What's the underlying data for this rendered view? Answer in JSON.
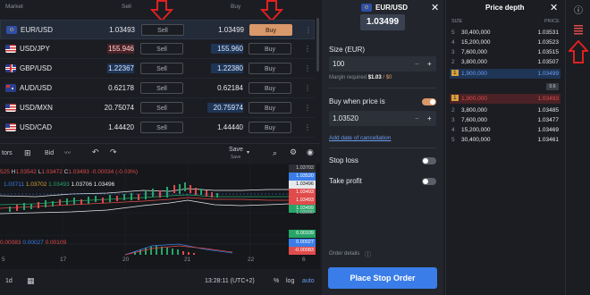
{
  "market": {
    "header": {
      "market": "Market",
      "sell": "Sell",
      "buy": "Buy"
    },
    "rows": [
      {
        "symbol": "EUR/USD",
        "sell_price": "1.03493",
        "sell_label": "Sell",
        "buy_price": "1.03499",
        "buy_label": "Buy",
        "selected": true
      },
      {
        "symbol": "USD/JPY",
        "sell_price": "155.946",
        "sell_label": "Sell",
        "buy_price": "155.960",
        "buy_label": "Buy"
      },
      {
        "symbol": "GBP/USD",
        "sell_price": "1.22367",
        "sell_label": "Sell",
        "buy_price": "1.22380",
        "buy_label": "Buy"
      },
      {
        "symbol": "AUD/USD",
        "sell_price": "0.62178",
        "sell_label": "Sell",
        "buy_price": "0.62184",
        "buy_label": "Buy"
      },
      {
        "symbol": "USD/MXN",
        "sell_price": "20.75074",
        "sell_label": "Sell",
        "buy_price": "20.75974",
        "buy_label": "Buy"
      },
      {
        "symbol": "USD/CAD",
        "sell_price": "1.44420",
        "sell_label": "Sell",
        "buy_price": "1.44440",
        "buy_label": "Buy"
      }
    ]
  },
  "chart": {
    "toolbar": {
      "indicators": "tors",
      "bid": "Bid",
      "save": "Save",
      "save_sub": "Save"
    },
    "ohlc": {
      "o": "525",
      "h_label": "H",
      "h": "1.03542",
      "l_label": "L",
      "l": "1.03472",
      "c_label": "C",
      "c": "1.03493",
      "chg": "-0.00034 (-0.03%)"
    },
    "ma_values": [
      "1.03711",
      "1.03702",
      "1.03493",
      "1.03706",
      "1.03496"
    ],
    "osc_values": [
      "0.00083",
      "0.00027",
      "0.00109"
    ],
    "price_labels": [
      "1.03702",
      "1.03520",
      "1.03496",
      "1.03493",
      "1.03493",
      "1.03499",
      "1.03000",
      "0.00109",
      "0.00027",
      "-0.00083"
    ],
    "x_labels": [
      "5",
      "17",
      "20",
      "21",
      "22",
      "6"
    ],
    "bottom": {
      "period": "1d",
      "time": "13:28:11 (UTC+2)",
      "pct": "%",
      "log": "log",
      "auto": "auto"
    }
  },
  "order": {
    "pair": "EUR/USD",
    "price": "1.03499",
    "size_label": "Size (EUR)",
    "size_value": "100",
    "margin_text": "Margin required",
    "margin_value": "$1.03",
    "margin_suffix": "/ $0",
    "buy_when_label": "Buy when price is",
    "buy_when_value": "1.03520",
    "add_date": "Add date of cancellation",
    "stop_loss": "Stop loss",
    "take_profit": "Take profit",
    "order_details": "Order details",
    "place_button": "Place Stop Order"
  },
  "depth": {
    "title": "Price depth",
    "col_size": "SIZE",
    "col_price": "PRICE",
    "asks": [
      {
        "lv": "5",
        "size": "30,400,000",
        "price": "1.03531"
      },
      {
        "lv": "4",
        "size": "15,200,000",
        "price": "1.03523"
      },
      {
        "lv": "3",
        "size": "7,600,000",
        "price": "1.03515"
      },
      {
        "lv": "2",
        "size": "3,800,000",
        "price": "1.03507"
      },
      {
        "lv": "1",
        "size": "1,900,000",
        "price": "1.03499"
      }
    ],
    "spread": "0.6",
    "bids": [
      {
        "lv": "1",
        "size": "1,900,000",
        "price": "1.03493"
      },
      {
        "lv": "2",
        "size": "3,800,000",
        "price": "1.03485"
      },
      {
        "lv": "3",
        "size": "7,600,000",
        "price": "1.03477"
      },
      {
        "lv": "4",
        "size": "15,200,000",
        "price": "1.03469"
      },
      {
        "lv": "5",
        "size": "30,400,000",
        "price": "1.03461"
      }
    ]
  },
  "colors": {
    "accent": "#d9986a",
    "blue": "#3a7de8",
    "red": "#e04b4b",
    "green": "#27a567"
  }
}
